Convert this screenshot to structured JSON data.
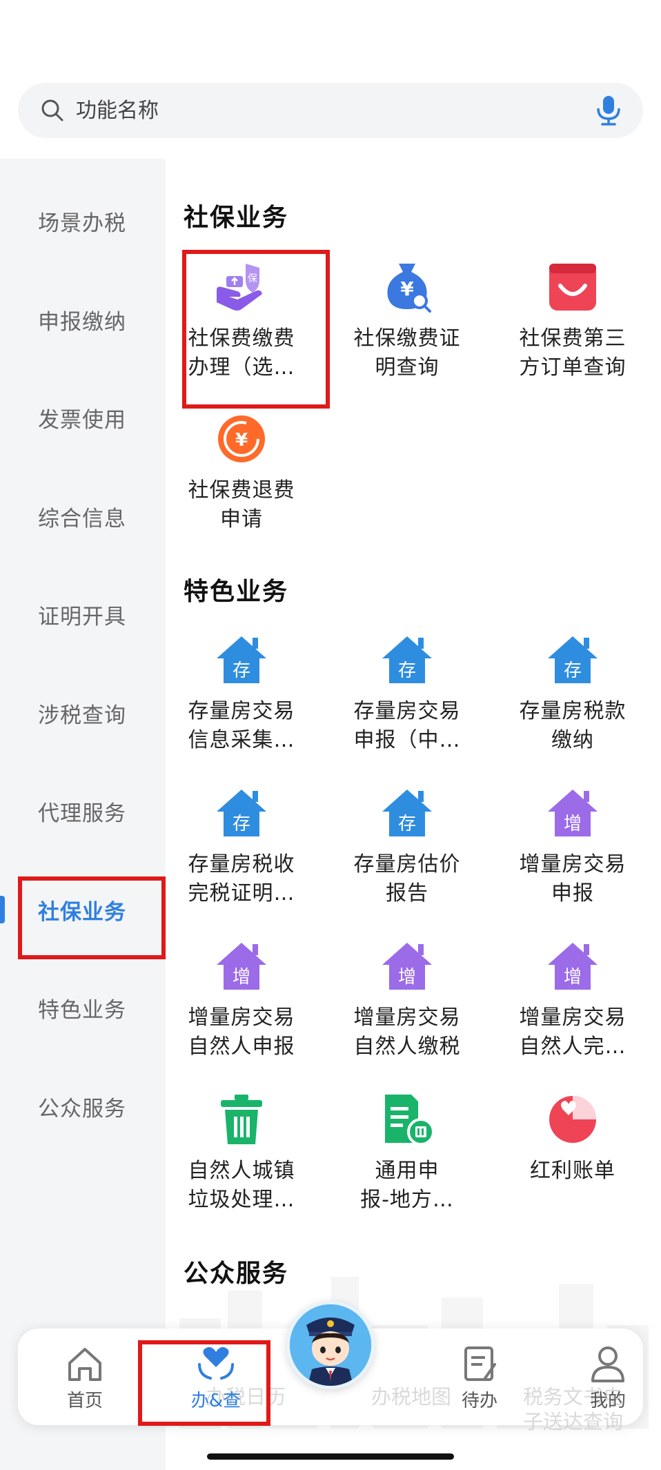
{
  "search": {
    "placeholder": "功能名称"
  },
  "sidebar": {
    "items": [
      {
        "label": "场景办税"
      },
      {
        "label": "申报缴纳"
      },
      {
        "label": "发票使用"
      },
      {
        "label": "综合信息"
      },
      {
        "label": "证明开具"
      },
      {
        "label": "涉税查询"
      },
      {
        "label": "代理服务"
      },
      {
        "label": "社保业务",
        "active": true
      },
      {
        "label": "特色业务"
      },
      {
        "label": "公众服务"
      }
    ]
  },
  "sections": {
    "social": {
      "title": "社保业务",
      "items": [
        {
          "l1": "社保费缴费",
          "l2": "办理（选…",
          "icon": "insurance-hand-icon"
        },
        {
          "l1": "社保缴费证",
          "l2": "明查询",
          "icon": "yen-bag-search-icon"
        },
        {
          "l1": "社保费第三",
          "l2": "方订单查询",
          "icon": "shopping-bag-icon"
        },
        {
          "l1": "社保费退费",
          "l2": "申请",
          "icon": "yen-refund-icon"
        }
      ]
    },
    "special": {
      "title": "特色业务",
      "items": [
        {
          "l1": "存量房交易",
          "l2": "信息采集…",
          "icon": "house-cun-icon",
          "glyph": "存"
        },
        {
          "l1": "存量房交易",
          "l2": "申报（中…",
          "icon": "house-cun-icon",
          "glyph": "存"
        },
        {
          "l1": "存量房税款",
          "l2": "缴纳",
          "icon": "house-cun-icon",
          "glyph": "存"
        },
        {
          "l1": "存量房税收",
          "l2": "完税证明…",
          "icon": "house-cun-icon",
          "glyph": "存"
        },
        {
          "l1": "存量房估价",
          "l2": "报告",
          "icon": "house-cun-icon",
          "glyph": "存"
        },
        {
          "l1": "增量房交易",
          "l2": "申报",
          "icon": "house-zeng-icon",
          "glyph": "增"
        },
        {
          "l1": "增量房交易",
          "l2": "自然人申报",
          "icon": "house-zeng-icon",
          "glyph": "增"
        },
        {
          "l1": "增量房交易",
          "l2": "自然人缴税",
          "icon": "house-zeng-icon",
          "glyph": "增"
        },
        {
          "l1": "增量房交易",
          "l2": "自然人完…",
          "icon": "house-zeng-icon",
          "glyph": "增"
        },
        {
          "l1": "自然人城镇",
          "l2": "垃圾处理…",
          "icon": "trash-bin-icon"
        },
        {
          "l1": "通用申",
          "l2": "报-地方…",
          "icon": "document-bin-icon"
        },
        {
          "l1": "红利账单",
          "l2": "",
          "icon": "heart-pie-icon"
        }
      ]
    },
    "public": {
      "title": "公众服务"
    }
  },
  "ghost_labels": {
    "tax_calendar": "办税日历",
    "tax_map": "办税地图",
    "service_line1": "税务文书电",
    "service_line2": "子送达查询"
  },
  "nav": {
    "home": "首页",
    "query": "办&查",
    "todo": "待办",
    "mine": "我的"
  },
  "colors": {
    "accent": "#2f7fe0",
    "highlight": "#e01919",
    "house_blue": "#2f8de0",
    "house_purple": "#9b6be8",
    "green": "#19b46a",
    "red": "#ef4456",
    "orange": "#ff6a2a"
  }
}
